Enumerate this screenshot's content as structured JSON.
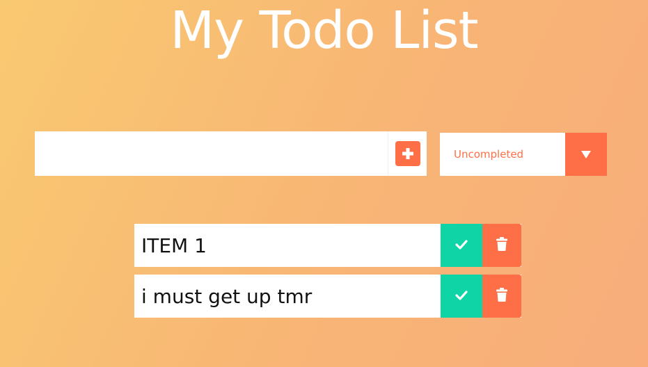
{
  "header": {
    "title": "My Todo List"
  },
  "add_form": {
    "input_value": "",
    "input_placeholder": "",
    "add_button_icon": "plus-square-icon"
  },
  "filter": {
    "selected": "Uncompleted",
    "arrow_icon": "caret-down-icon"
  },
  "todos": [
    {
      "text": "ITEM 1",
      "complete_icon": "check-icon",
      "delete_icon": "trash-icon"
    },
    {
      "text": "i must get up tmr",
      "complete_icon": "check-icon",
      "delete_icon": "trash-icon"
    }
  ],
  "colors": {
    "accent": "#ff6f47",
    "complete": "#0fd4a5",
    "gradient_start": "#f9c971",
    "gradient_end": "#f8ad7b"
  }
}
